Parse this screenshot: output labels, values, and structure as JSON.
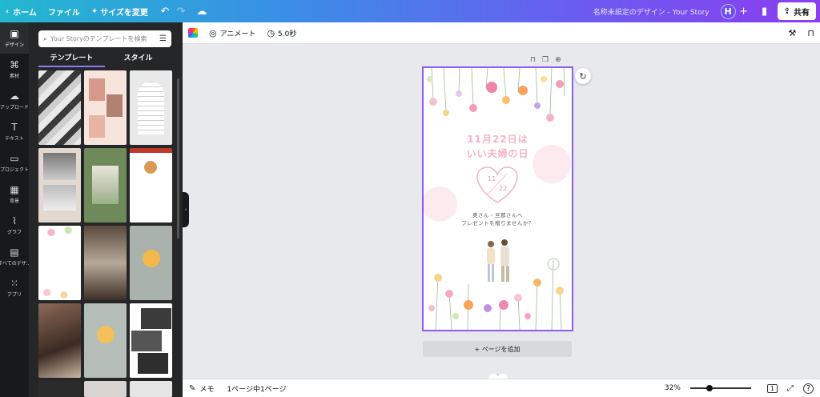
{
  "topbar": {
    "home": "ホーム",
    "file": "ファイル",
    "resize": "サイズを変更",
    "doc_title": "名称未設定のデザイン - Your Story",
    "avatar_initial": "H",
    "share": "共有",
    "icons": [
      "chevron-left-icon",
      "undo-icon",
      "redo-icon",
      "cloud-save-icon",
      "plus-icon",
      "analytics-icon",
      "share-icon"
    ]
  },
  "rail": {
    "items": [
      {
        "label": "デザイン",
        "icon": "▣"
      },
      {
        "label": "素材",
        "icon": "⌘"
      },
      {
        "label": "アップロード",
        "icon": "☁"
      },
      {
        "label": "テキスト",
        "icon": "T"
      },
      {
        "label": "プロジェクト",
        "icon": "▭"
      },
      {
        "label": "背景",
        "icon": "▦"
      },
      {
        "label": "グラフ",
        "icon": "⌇"
      },
      {
        "label": "すべてのデザ...",
        "icon": "▤"
      },
      {
        "label": "アプリ",
        "icon": "⁙"
      }
    ]
  },
  "panel": {
    "search_placeholder": "Your Storyのテンプレートを検索",
    "tab_templates": "テンプレート",
    "tab_styles": "スタイル"
  },
  "toolbar": {
    "animate": "アニメート",
    "duration": "5.0秒"
  },
  "design": {
    "headline_line1": "11月22日は",
    "headline_line2": "いい夫婦の日",
    "heart_top": "11",
    "heart_bottom": "22",
    "sub_line1": "奥さん・旦那さんへ",
    "sub_line2": "プレゼントを贈りませんか？"
  },
  "canvas": {
    "add_page": "+ ページを追加"
  },
  "bottom": {
    "notes": "メモ",
    "page_info": "1ページ中1ページ",
    "zoom": "32%",
    "zoom_level": 0.32,
    "page_count": "1"
  }
}
